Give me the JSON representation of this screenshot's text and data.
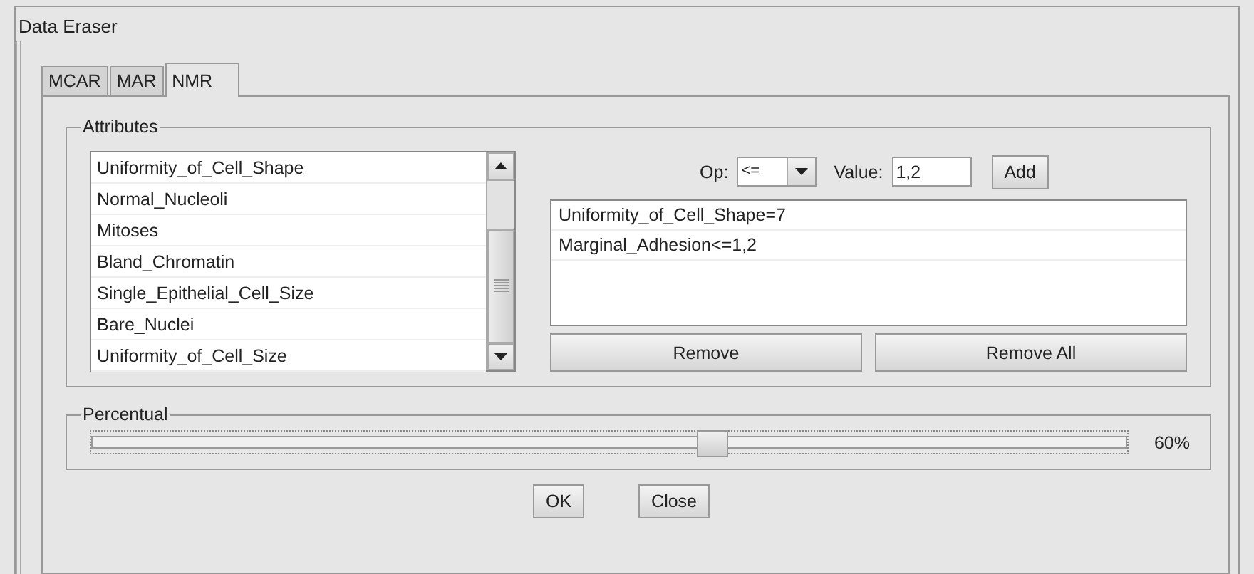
{
  "window": {
    "title": "Data Eraser"
  },
  "tabs": [
    {
      "label": "MCAR",
      "selected": false
    },
    {
      "label": "MAR",
      "selected": false
    },
    {
      "label": "NMR",
      "selected": true
    }
  ],
  "attributes": {
    "title": "Attributes",
    "items": [
      "Uniformity_of_Cell_Shape",
      "Normal_Nucleoli",
      "Mitoses",
      "Bland_Chromatin",
      "Single_Epithelial_Cell_Size",
      "Bare_Nuclei",
      "Uniformity_of_Cell_Size"
    ],
    "op_label": "Op:",
    "op_value": "<=",
    "value_label": "Value:",
    "value": "1,2",
    "add_button": "Add",
    "conditions": [
      "Uniformity_of_Cell_Shape=7",
      "Marginal_Adhesion<=1,2"
    ],
    "remove_button": "Remove",
    "remove_all_button": "Remove All"
  },
  "percentual": {
    "title": "Percentual",
    "level": 0.6,
    "reading": "60%"
  },
  "buttons": [
    "OK",
    "Close"
  ]
}
